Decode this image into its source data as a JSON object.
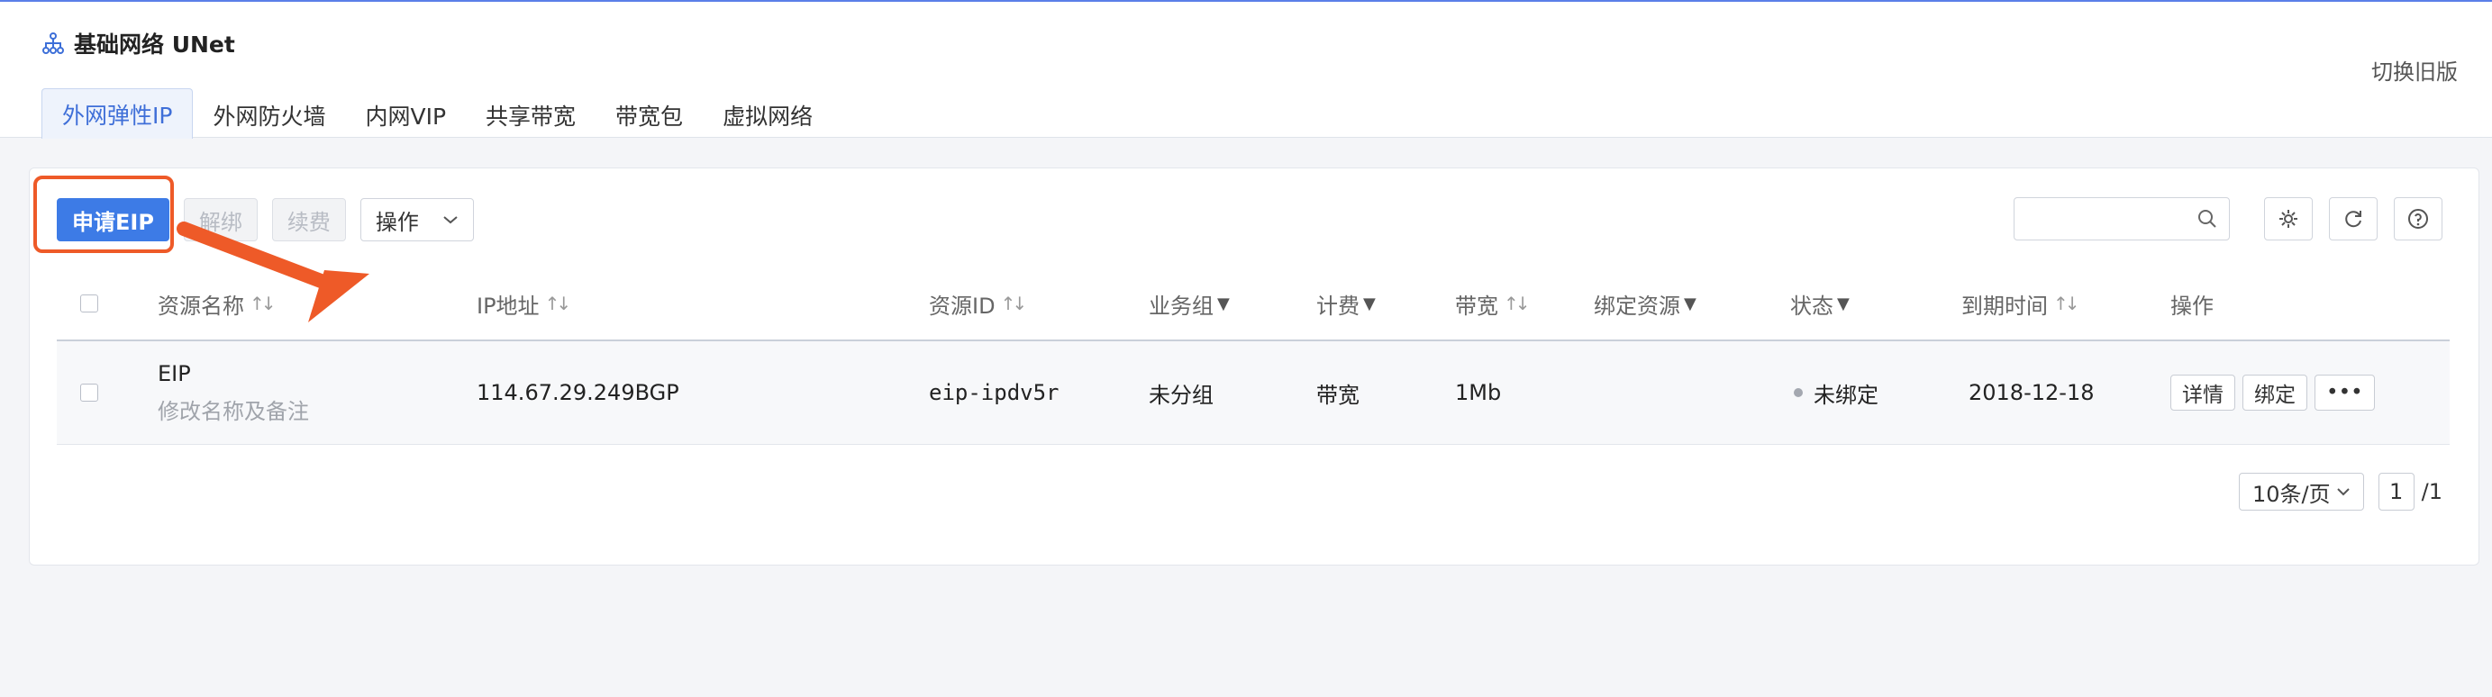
{
  "app": {
    "title": "基础网络 UNet",
    "switch_old_label": "切换旧版"
  },
  "tabs": [
    {
      "label": "外网弹性IP",
      "active": true
    },
    {
      "label": "外网防火墙"
    },
    {
      "label": "内网VIP"
    },
    {
      "label": "共享带宽"
    },
    {
      "label": "带宽包"
    },
    {
      "label": "虚拟网络"
    }
  ],
  "toolbar": {
    "apply_eip": "申请EIP",
    "unbind": "解绑",
    "renew": "续费",
    "operations": "操作",
    "search_placeholder": ""
  },
  "table": {
    "columns": {
      "name": "资源名称",
      "ip": "IP地址",
      "resource_id": "资源ID",
      "business_group": "业务组",
      "billing": "计费",
      "bandwidth": "带宽",
      "bound_resource": "绑定资源",
      "status": "状态",
      "expire": "到期时间",
      "actions": "操作"
    },
    "rows": [
      {
        "name": "EIP",
        "remark": "修改名称及备注",
        "ip": "114.67.29.249BGP",
        "resource_id": "eip-ipdv5r",
        "business_group": "未分组",
        "billing": "带宽",
        "bandwidth": "1Mb",
        "bound_resource": "",
        "status": "未绑定",
        "expire": "2018-12-18",
        "details": "详情",
        "bind": "绑定",
        "more": "•••"
      }
    ]
  },
  "pagination": {
    "page_size": "10条/页",
    "current": "1",
    "total": "/1"
  },
  "colors": {
    "accent": "#3d7be6",
    "highlight": "#ee5a28"
  }
}
